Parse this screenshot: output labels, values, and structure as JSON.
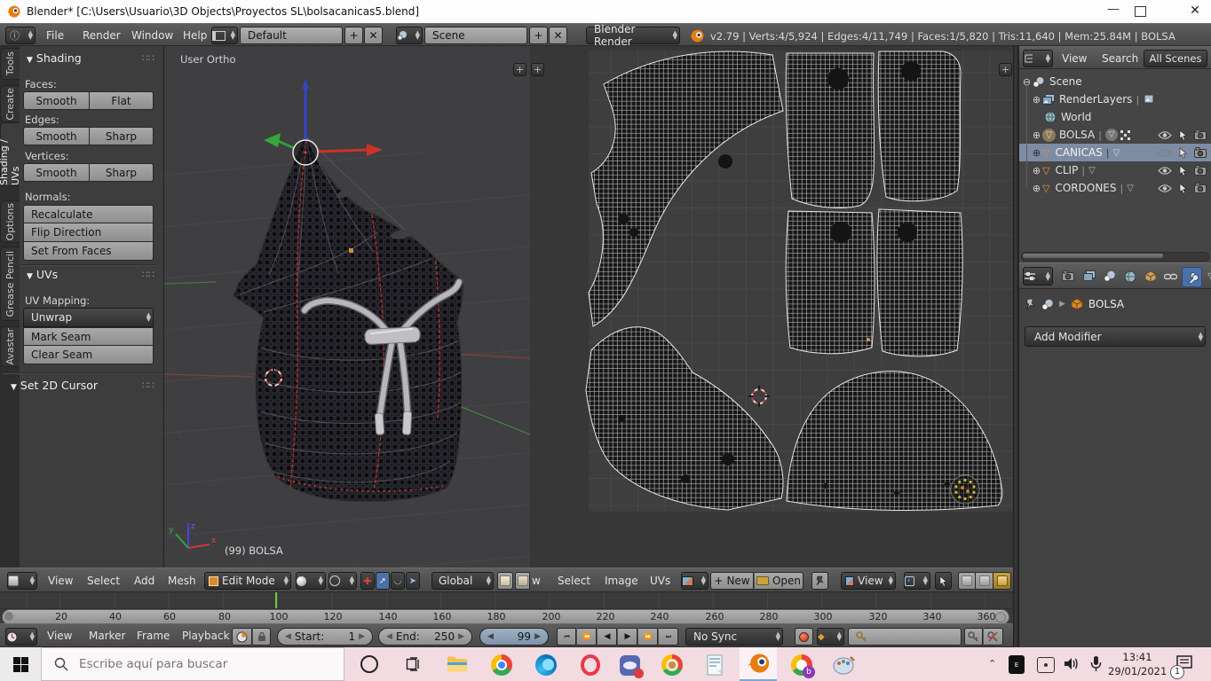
{
  "window": {
    "title": "Blender* [C:\\Users\\Usuario\\3D Objects\\Proyectos SL\\bolsacanicas5.blend]"
  },
  "topbar": {
    "menus": {
      "file": "File",
      "render": "Render",
      "window": "Window",
      "help": "Help"
    },
    "layout_value": "Default",
    "scene_value": "Scene",
    "engine_value": "Blender Render",
    "stats": "v2.79 | Verts:4/5,924 | Edges:4/11,749 | Faces:1/5,820 | Tris:11,640 | Mem:25.84M | BOLSA"
  },
  "toolshelf": {
    "tabs": [
      "Tools",
      "Create",
      "Shading / UVs",
      "Options",
      "Grease Pencil",
      "Avastar"
    ],
    "shading": {
      "title": "Shading",
      "faces_label": "Faces:",
      "edges_label": "Edges:",
      "vertices_label": "Vertices:",
      "normals_label": "Normals:",
      "smooth": "Smooth",
      "flat": "Flat",
      "sharp": "Sharp",
      "recalculate": "Recalculate",
      "flip_direction": "Flip Direction",
      "set_from_faces": "Set From Faces"
    },
    "uvs": {
      "title": "UVs",
      "mapping_label": "UV Mapping:",
      "unwrap": "Unwrap",
      "mark_seam": "Mark Seam",
      "clear_seam": "Clear Seam"
    },
    "cursor_panel_title": "Set 2D Cursor"
  },
  "viewport": {
    "view_label": "User Ortho",
    "object_label": "(99) BOLSA",
    "header": {
      "view": "View",
      "select": "Select",
      "add": "Add",
      "mesh": "Mesh",
      "mode": "Edit Mode",
      "orientation": "Global"
    },
    "axis": {
      "x": "x",
      "y": "y",
      "z": "z"
    }
  },
  "uv_editor": {
    "header": {
      "view_clipped": "w",
      "select": "Select",
      "image": "Image",
      "uvs": "UVs",
      "new_label": "New",
      "open_label": "Open",
      "mode": "View"
    }
  },
  "outliner": {
    "header": {
      "view": "View",
      "search": "Search",
      "scope": "All Scenes"
    },
    "items": [
      {
        "label": "Scene"
      },
      {
        "label": "RenderLayers"
      },
      {
        "label": "World"
      },
      {
        "label": "BOLSA"
      },
      {
        "label": "CANICAS"
      },
      {
        "label": "CLIP"
      },
      {
        "label": "CORDONES"
      }
    ]
  },
  "properties": {
    "object_name": "BOLSA",
    "add_modifier": "Add Modifier"
  },
  "timeline": {
    "header": {
      "view": "View",
      "marker": "Marker",
      "frame": "Frame",
      "playback": "Playback",
      "start_label": "Start:",
      "start_value": "1",
      "end_label": "End:",
      "end_value": "250",
      "current_frame": "99",
      "sync": "No Sync"
    },
    "ticks": [
      "20",
      "40",
      "60",
      "80",
      "100",
      "120",
      "140",
      "160",
      "180",
      "200",
      "220",
      "240",
      "260",
      "280",
      "300",
      "320",
      "340",
      "360"
    ]
  },
  "taskbar": {
    "search_placeholder": "Escribe aquí para buscar",
    "time": "13:41",
    "date": "29/01/2021",
    "notification_count": "1"
  }
}
